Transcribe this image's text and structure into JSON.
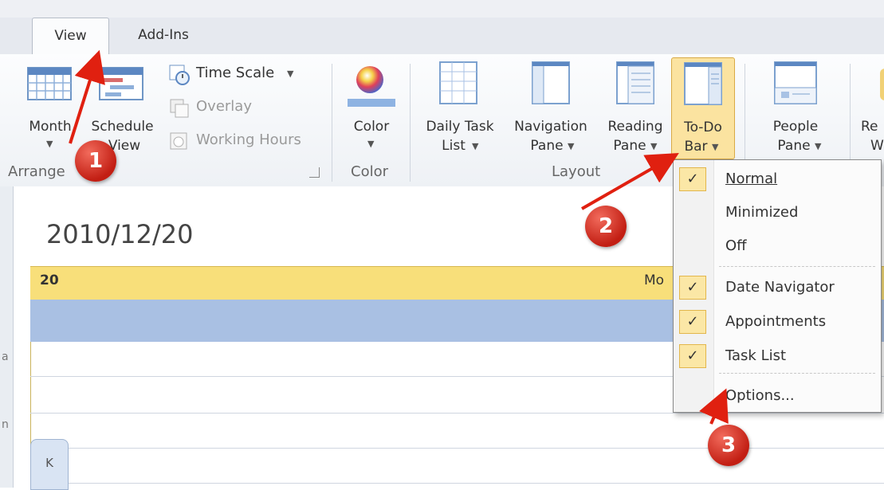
{
  "tabs": [
    {
      "label": "View",
      "active": true
    },
    {
      "label": "Add-Ins",
      "active": false
    }
  ],
  "ribbon": {
    "arrange": {
      "month_label": "Month",
      "schedule_label": "Schedule",
      "view_label": "View",
      "group_label": "Arrange",
      "time_scale_label": "Time Scale",
      "overlay_label": "Overlay",
      "working_hours_label": "Working Hours"
    },
    "color": {
      "button_label": "Color",
      "group_label": "Color"
    },
    "layout": {
      "group_label": "Layout",
      "daily_task_list": [
        "Daily Task",
        "List"
      ],
      "navigation_pane": [
        "Navigation",
        "Pane"
      ],
      "reading_pane": [
        "Reading",
        "Pane"
      ],
      "todo_bar": [
        "To-Do",
        "Bar"
      ]
    },
    "people": {
      "people_pane": [
        "People",
        "Pane"
      ],
      "reminders_partial": [
        "Re",
        "W"
      ]
    }
  },
  "calendar": {
    "date_title": "2010/12/20",
    "day_number": "20",
    "day_name_partial": "Mo",
    "side_marks": [
      "a",
      "n"
    ],
    "collapse_tab": "K"
  },
  "todo_menu": {
    "items": [
      {
        "label": "Normal",
        "checked": true
      },
      {
        "label": "Minimized",
        "checked": false
      },
      {
        "label": "Off",
        "checked": false
      },
      {
        "label": "Date Navigator",
        "checked": true
      },
      {
        "label": "Appointments",
        "checked": true
      },
      {
        "label": "Task List",
        "checked": true
      },
      {
        "label": "Options...",
        "checked": false
      }
    ],
    "check_glyph": "✓"
  },
  "annotations": [
    "1",
    "2",
    "3"
  ],
  "colors": {
    "accent_yellow": "#f8df7a",
    "allday_blue": "#a9c0e3",
    "badge_red": "#c21e13",
    "arrow_red": "#e02010"
  }
}
